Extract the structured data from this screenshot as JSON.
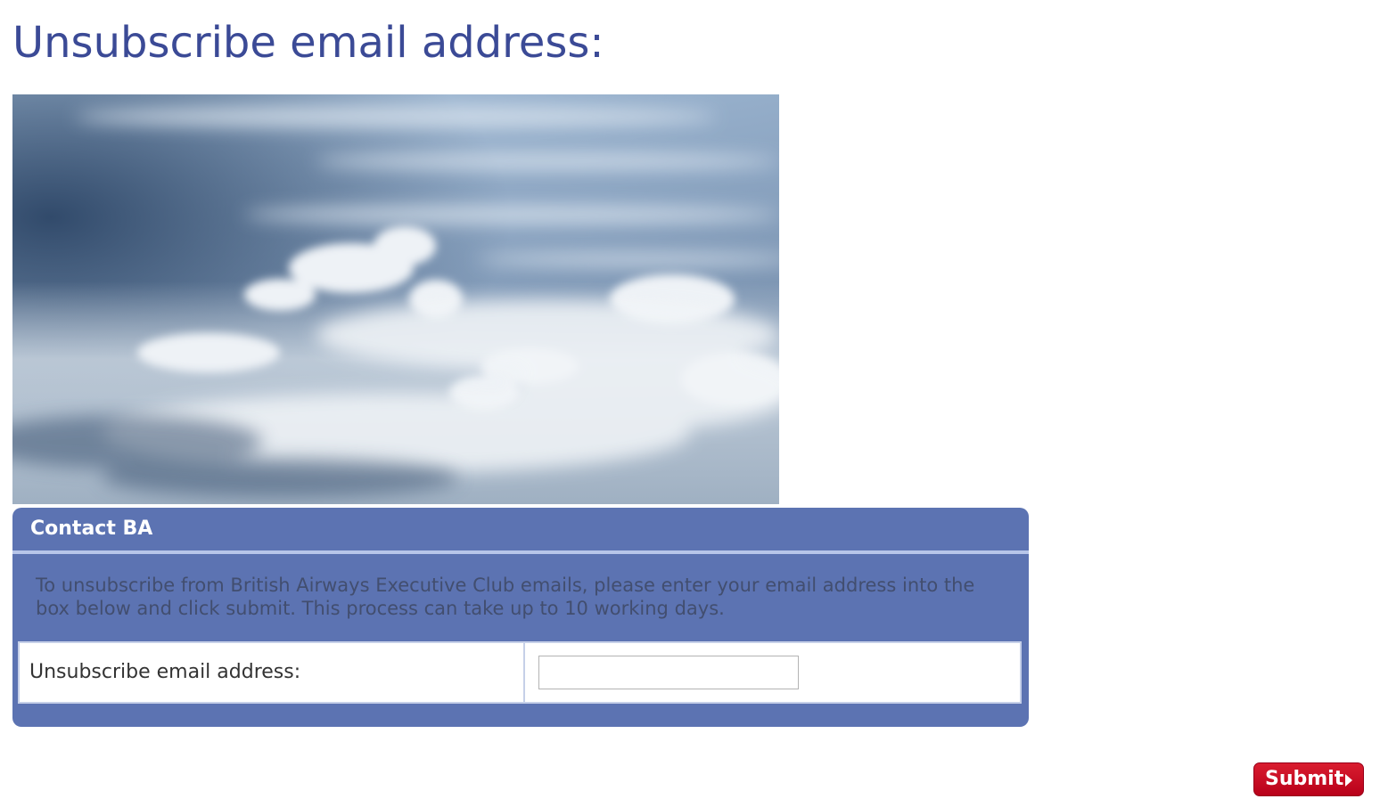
{
  "page": {
    "title": "Unsubscribe email address:"
  },
  "hero_image": {
    "subject": "cloudscape",
    "colors": {
      "sky_top": "#b8cde2",
      "sky_dark": "#2e4868",
      "cloud": "#e8edf2"
    }
  },
  "panel": {
    "title": "Contact BA",
    "description": "To unsubscribe from British Airways Executive Club emails, please enter your email address into the box below and click submit. This process can take up to 10 working days.",
    "colors": {
      "background": "#5c73b2",
      "divider": "#b7c5e9"
    }
  },
  "form": {
    "email_label": "Unsubscribe email address:",
    "email_value": "",
    "email_placeholder": ""
  },
  "actions": {
    "submit_label": "Submit",
    "submit_icon": "arrow-right-icon",
    "submit_color": "#c8102e"
  }
}
